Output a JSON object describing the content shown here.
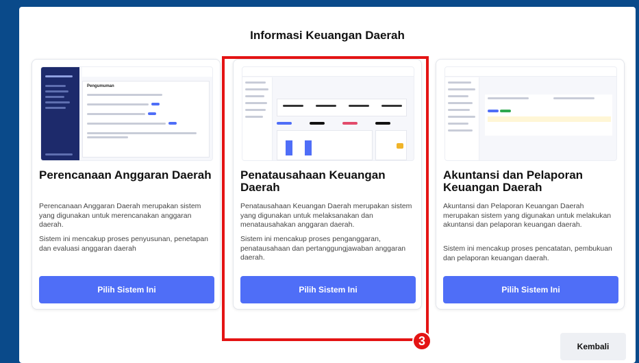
{
  "header": {
    "title": "Informasi Keuangan Daerah"
  },
  "cards": [
    {
      "title": "Perencanaan Anggaran Daerah",
      "desc1": "Perencanaan Anggaran Daerah merupakan sistem yang digunakan untuk merencanakan anggaran daerah.",
      "desc2": "Sistem ini mencakup proses penyusunan, penetapan dan evaluasi anggaran daerah",
      "button": "Pilih Sistem Ini",
      "thumb_heading": "Pengumuman"
    },
    {
      "title": "Penatausahaan Keuangan Daerah",
      "desc1": "Penatausahaan Keuangan Daerah merupakan sistem yang digunakan untuk melaksanakan dan menatausahakan anggaran daerah.",
      "desc2": "Sistem ini mencakup proses penganggaran, penatausahaan dan pertanggungjawaban anggaran daerah.",
      "button": "Pilih Sistem Ini"
    },
    {
      "title": "Akuntansi dan Pelaporan Keuangan Daerah",
      "desc1": "Akuntansi dan Pelaporan Keuangan Daerah merupakan sistem yang digunakan untuk melakukan akuntansi dan pelaporan keuangan daerah.",
      "desc2": "Sistem ini mencakup proses pencatatan, pembukuan dan pelaporan keuangan daerah.",
      "button": "Pilih Sistem Ini"
    }
  ],
  "annotation": {
    "marker": "3"
  },
  "footer": {
    "back_button": "Kembali"
  },
  "colors": {
    "primary": "#4f6ef7",
    "highlight": "#e41414",
    "background": "#0a4a8a"
  }
}
